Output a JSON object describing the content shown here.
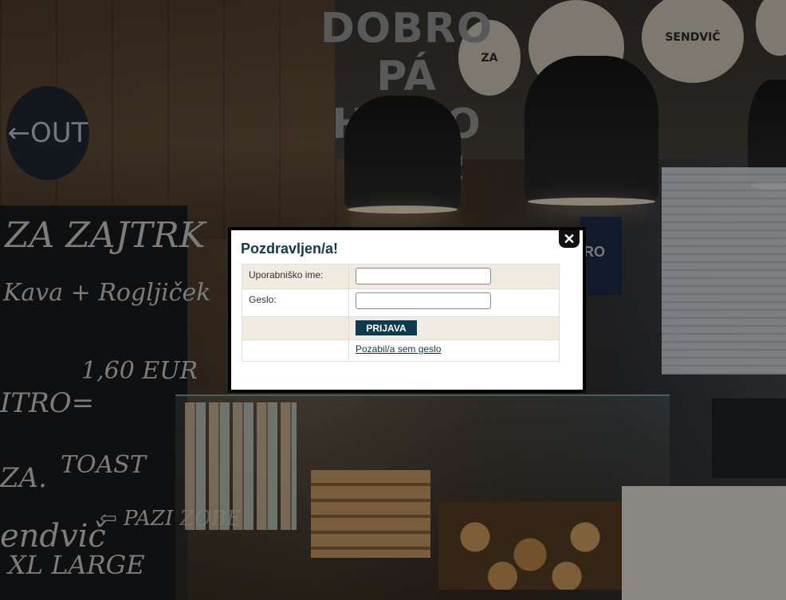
{
  "background": {
    "sign_line1": "DOBRO",
    "sign_line2": "PÁ HITRO",
    "sign_sub": "• • • ŠOLSKI BISTRO • • •",
    "out_sign": "←OUT",
    "menu_disc_sendvic": "SENDVIČ",
    "menu_disc_pizza": "ZA",
    "tv_text": "RO",
    "chalk_zajtrk": "ZA ZAJTRK",
    "chalk_kava": "Kava + Rogljiček",
    "chalk_price": "1,60 EUR",
    "chalk_hitro": "ITRO=",
    "chalk_toast": "TOAST",
    "chalk_za": "ZA.",
    "chalk_sendvic": "endvič",
    "chalk_large": "XL LARGE",
    "chalk_arrow": "⇦ PAZI ZOBE"
  },
  "login": {
    "title": "Pozdravljen/a!",
    "close_symbol": "✕",
    "username_label": "Uporabniško ime:",
    "username_value": "",
    "password_label": "Geslo:",
    "password_value": "",
    "submit_label": "PRIJAVA",
    "forgot_label": "Pozabil/a sem geslo"
  },
  "colors": {
    "accent": "#0e3b4c",
    "row_beige": "#f1ebe1"
  }
}
